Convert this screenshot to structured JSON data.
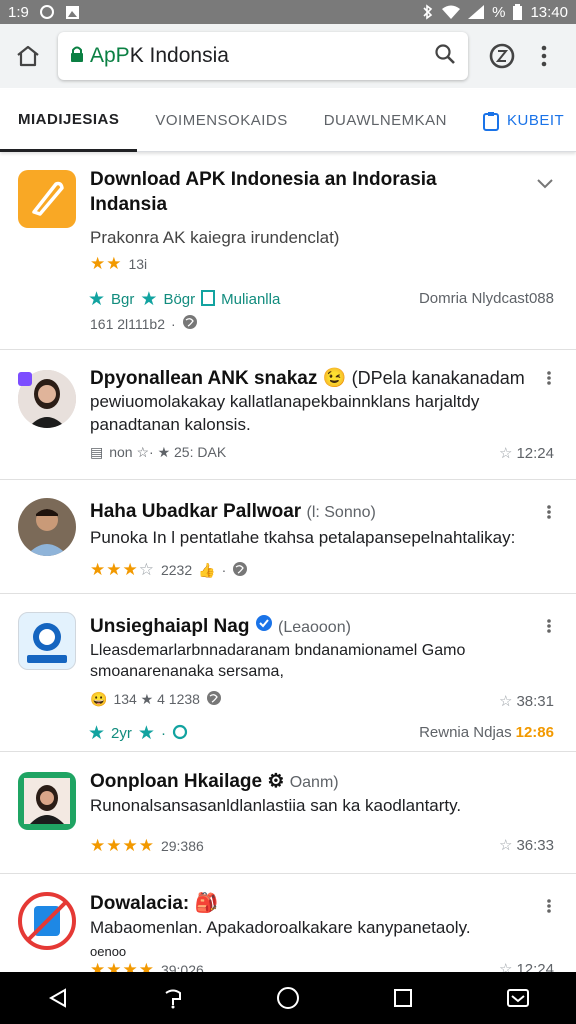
{
  "status_bar": {
    "time": "1:9",
    "battery": "%",
    "clock": "13:40"
  },
  "browser": {
    "url_prefix": "ApP",
    "url_rest": "K Indonsia"
  },
  "tabs": [
    {
      "label": "MIADIJESIAS",
      "active": true
    },
    {
      "label": "VOIMENSOKAIDS",
      "active": false
    },
    {
      "label": "DUAWLNEMKAN",
      "active": false
    },
    {
      "label": "KUBEIT",
      "active": false
    }
  ],
  "cards": [
    {
      "title_line1": "Download APK Indonesia   an Indorasia",
      "title_line2": "Indansia",
      "subtitle": "Prakonra AK kaiegra irundenclat)",
      "rating_stars": 2,
      "rating_text": "13i",
      "chips": [
        "Bgr",
        "Bögr",
        "Mulianlla"
      ],
      "footer_left": "161 2l111b2",
      "footer_right": "Domria Nlydcast088"
    },
    {
      "title": "Dpyonallean ANK snakaz",
      "title_extra": "(DPela kanakanadam",
      "desc_line1": "pewiuomolakakay kallatlanapekbainnklans harjaltdy",
      "desc_line2": "panadtanan kalonsis.",
      "meta": "non ☆· ★ 25: DAK",
      "right": "12:24"
    },
    {
      "title": "Haha Ubadkar Pallwoar",
      "title_extra": "(l: Sonno)",
      "desc_line1": "Punoka In l pentatlahe tkahsa  petalapansepelnahtalikay:",
      "rating_stars": 3,
      "meta": "2232"
    },
    {
      "title": "Unsieghaiapl Nag",
      "title_extra": "(Leaooon)",
      "desc_line1": "Lleasdemarlarbnnadaranam bndanamionamel Gamo",
      "desc_line2": "smoanarenanaka sersama,",
      "meta": "134 ★ 4 1238",
      "right": "38:31",
      "teal_left": "2yr",
      "footer_right_prefix": "Rewnia Ndjas",
      "footer_right_accent": "12:86"
    },
    {
      "title": "Oonploan Hkailage",
      "title_extra": "Oanm)",
      "desc_line1": "Runonalsansasanldlanlastiia  san ka kaodlantarty.",
      "rating_stars": 4,
      "meta": "29:386",
      "right": "36:33"
    },
    {
      "title": "Dowalacia:",
      "desc_line1": "Mabaomenlan. Apakadoroalkakare kanypanetaoly.",
      "desc_line2": "oenoo",
      "rating_stars": 4,
      "meta": "39:026",
      "right": "12:24"
    }
  ],
  "colors": {
    "accent_blue": "#1a73e8",
    "star_orange": "#f29900",
    "teal": "#12a3a0",
    "app_icon_orange": "#f9a825",
    "green_icon": "#1fa463"
  }
}
